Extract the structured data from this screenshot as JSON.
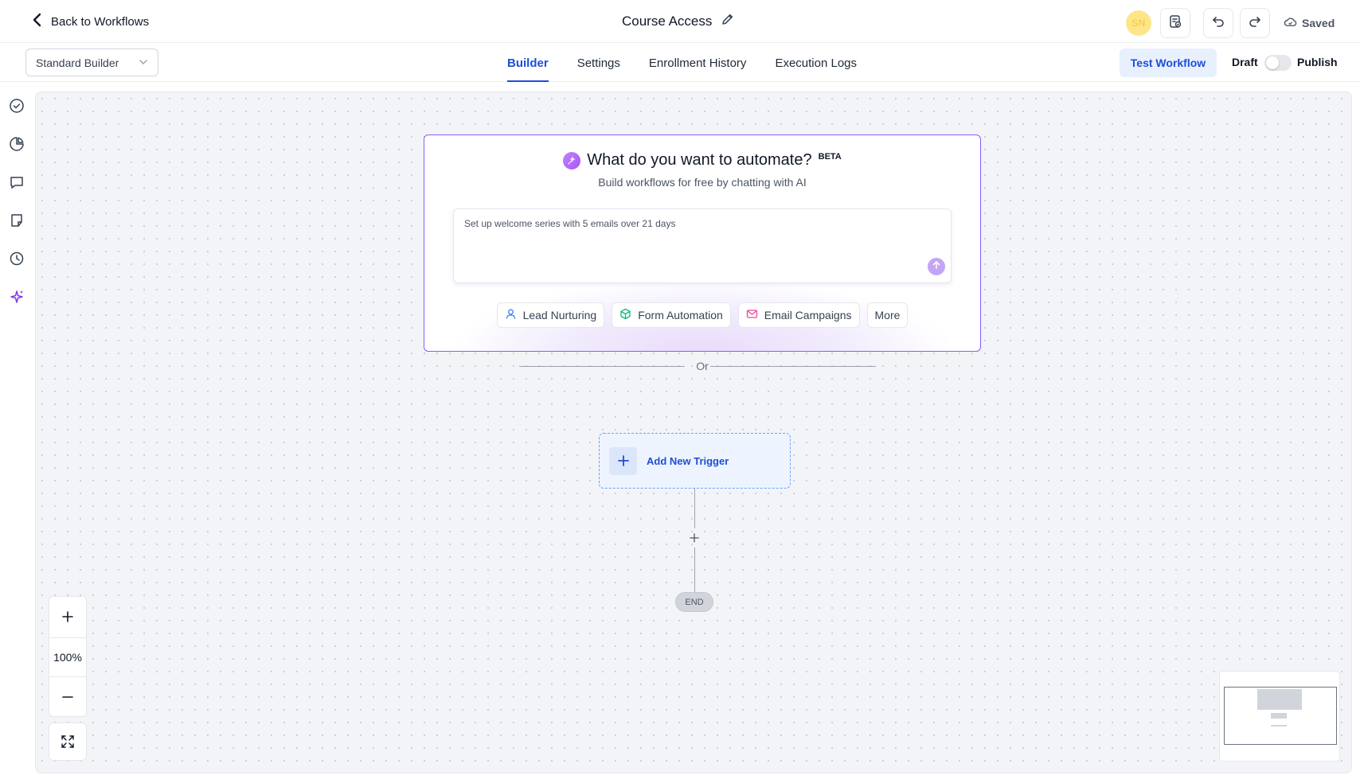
{
  "header": {
    "back_label": "Back to Workflows",
    "workflow_title": "Course Access",
    "avatar_initials": "SN",
    "save_status": "Saved"
  },
  "subheader": {
    "builder_mode": "Standard Builder",
    "tabs": [
      {
        "label": "Builder",
        "active": true
      },
      {
        "label": "Settings",
        "active": false
      },
      {
        "label": "Enrollment History",
        "active": false
      },
      {
        "label": "Execution Logs",
        "active": false
      }
    ],
    "test_button": "Test Workflow",
    "draft_label": "Draft",
    "publish_label": "Publish",
    "publish_toggle_on": false
  },
  "left_rail": {
    "icons": [
      "check-circle-icon",
      "pie-chart-icon",
      "comment-icon",
      "note-icon",
      "history-icon",
      "sparkles-icon"
    ]
  },
  "ai_card": {
    "title": "What do you want to automate?",
    "badge": "BETA",
    "subtitle": "Build workflows for free by chatting with AI",
    "prompt_text": "Set up welcome series with 5 emails over 21 days",
    "chips": [
      {
        "label": "Lead Nurturing",
        "icon": "user-icon"
      },
      {
        "label": "Form Automation",
        "icon": "cube-icon"
      },
      {
        "label": "Email Campaigns",
        "icon": "mail-icon"
      },
      {
        "label": "More",
        "icon": ""
      }
    ]
  },
  "flow": {
    "divider_label": "Or",
    "trigger_label": "Add New Trigger",
    "end_label": "END"
  },
  "zoom": {
    "level": "100%"
  },
  "colors": {
    "accent": "#1d4ed8",
    "ai_purple": "#8b5cf6",
    "canvas_bg": "#f3f4f7"
  }
}
